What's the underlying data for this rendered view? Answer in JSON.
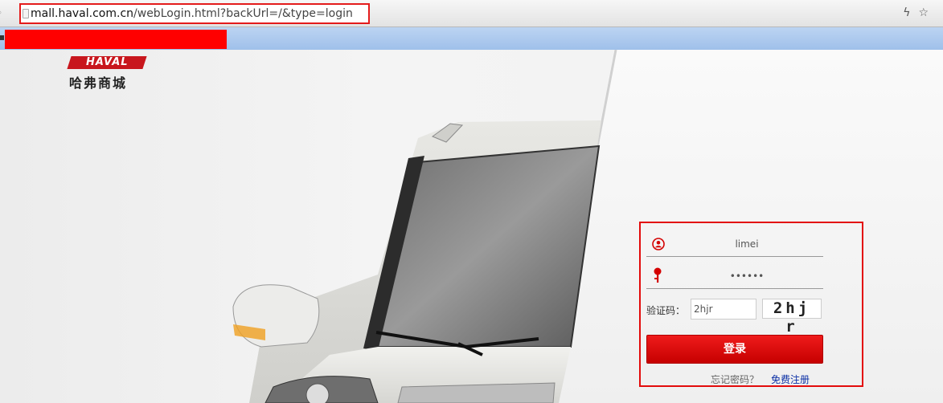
{
  "browser": {
    "url_domain": "mall.haval.com.cn",
    "url_path": "/webLogin.html?backUrl=/&type=login"
  },
  "brand": {
    "logo_badge": "HAVAL",
    "logo_name": "哈弗商城",
    "accent": "#e30b0b"
  },
  "login": {
    "username": "limei",
    "password_mask": "••••••",
    "captcha_label": "验证码：",
    "captcha_input": "2hjr",
    "captcha_image_text": "2hj r",
    "submit_label": "登录",
    "forgot_label": "忘记密码？",
    "register_label": "免费注册"
  }
}
